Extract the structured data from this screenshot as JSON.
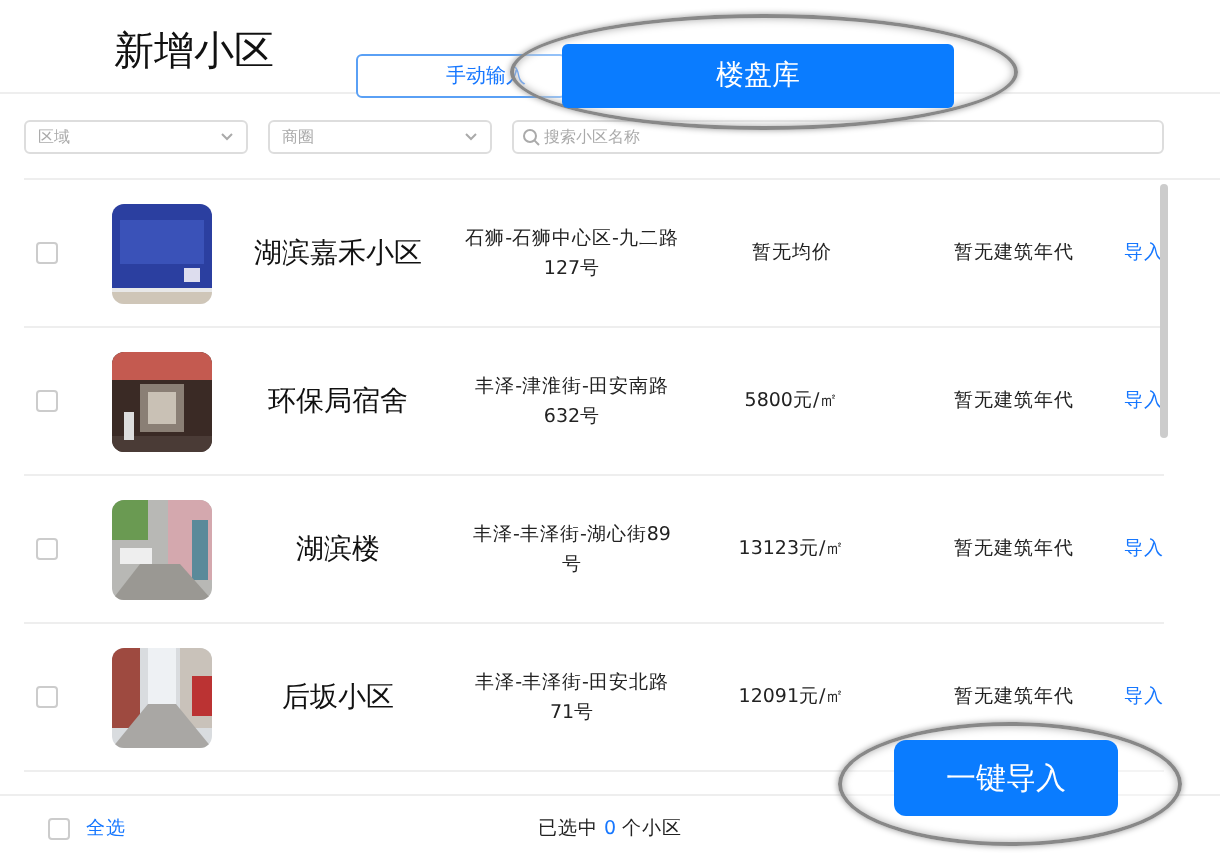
{
  "title": "新增小区",
  "tabs": [
    {
      "label": "手动输入",
      "selected": false
    },
    {
      "label": "楼盘库",
      "selected": true
    }
  ],
  "filters": [
    {
      "kind": "select",
      "placeholder": "区域"
    },
    {
      "kind": "select",
      "placeholder": "商圈"
    },
    {
      "kind": "search",
      "placeholder": "搜索小区名称"
    }
  ],
  "rows": [
    {
      "checked": false,
      "name": "湖滨嘉禾小区",
      "address": "石狮-石狮中心区-九二路127号",
      "price": "暂无均价",
      "year": "暂无建筑年代",
      "action": "导入"
    },
    {
      "checked": false,
      "name": "环保局宿舍",
      "address": "丰泽-津淮街-田安南路632号",
      "price": "5800元/㎡",
      "year": "暂无建筑年代",
      "action": "导入"
    },
    {
      "checked": false,
      "name": "湖滨楼",
      "address": "丰泽-丰泽街-湖心街89号",
      "price": "13123元/㎡",
      "year": "暂无建筑年代",
      "action": "导入"
    },
    {
      "checked": false,
      "name": "后坂小区",
      "address": "丰泽-丰泽街-田安北路71号",
      "price": "12091元/㎡",
      "year": "暂无建筑年代",
      "action": "导入"
    }
  ],
  "footer": {
    "select_all": {
      "label": "全选",
      "checked": false
    },
    "selected_prefix": "已选中",
    "selected_count": "0",
    "selected_suffix": "个小区",
    "import_button": "一键导入"
  }
}
